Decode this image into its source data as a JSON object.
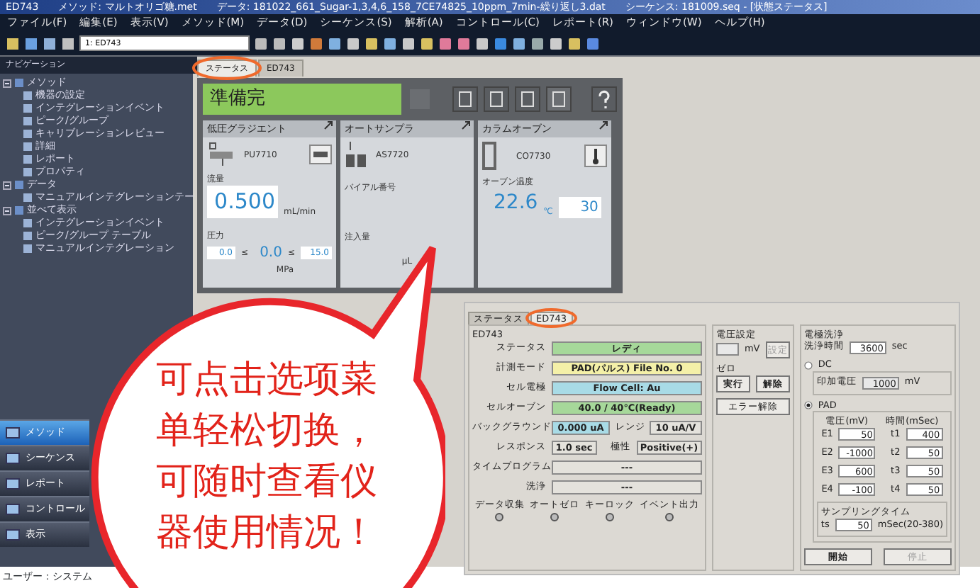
{
  "window": {
    "title": "ED743　　メソッド: マルトオリゴ糖.met　　データ: 181022_661_Sugar-1,3,4,6_158_7CE74825_10ppm_7min-繰り返し3.dat　　シーケンス: 181009.seq - [状態ステータス]"
  },
  "menu": [
    "ファイル(F)",
    "編集(E)",
    "表示(V)",
    "メソッド(M)",
    "データ(D)",
    "シーケンス(S)",
    "解析(A)",
    "コントロール(C)",
    "レポート(R)",
    "ウィンドウ(W)",
    "ヘルプ(H)"
  ],
  "toolbar": {
    "combo": "1: ED743"
  },
  "navigation": {
    "title": "ナビゲーション",
    "tree": [
      {
        "label": "メソッド",
        "expanded": true,
        "children": [
          {
            "label": "機器の設定"
          },
          {
            "label": "インテグレーションイベント"
          },
          {
            "label": "ピーク/グループ"
          },
          {
            "label": "キャリブレーションレビュー"
          },
          {
            "label": "詳細"
          },
          {
            "label": "レポート"
          },
          {
            "label": "プロパティ"
          }
        ]
      },
      {
        "label": "データ",
        "expanded": true,
        "children": [
          {
            "label": "マニュアルインテグレーションテー"
          }
        ]
      },
      {
        "label": "並べて表示",
        "expanded": true,
        "children": [
          {
            "label": "インテグレーションイベント"
          },
          {
            "label": "ピーク/グループ テーブル"
          },
          {
            "label": "マニュアルインテグレーション"
          }
        ]
      }
    ],
    "buttons": [
      {
        "label": "メソッド",
        "selected": true
      },
      {
        "label": "シーケンス",
        "selected": false
      },
      {
        "label": "レポート",
        "selected": false
      },
      {
        "label": "コントロール",
        "selected": false
      },
      {
        "label": "表示",
        "selected": false
      }
    ]
  },
  "tabs": [
    {
      "label": "ステータス",
      "selected": true
    },
    {
      "label": "ED743",
      "selected": false
    }
  ],
  "status": {
    "text": "準備完"
  },
  "modules": [
    {
      "kind": "pump",
      "title": "低圧グラジエント",
      "device": "PU7710",
      "flow_label": "流量",
      "flow": "0.500",
      "flow_unit": "mL/min",
      "pressure_label": "圧力",
      "pressure_min": "0.0",
      "pressure": "0.0",
      "pressure_max": "15.0",
      "le": "≤",
      "pressure_unit": "MPa"
    },
    {
      "kind": "sampler",
      "title": "オートサンプラ",
      "device": "AS7720",
      "vial_label": "バイアル番号",
      "volume_label": "注入量",
      "volume_unit": "μL"
    },
    {
      "kind": "oven",
      "title": "カラムオーブン",
      "device": "CO7730",
      "temp_label": "オーブン温度",
      "temp": "22.6",
      "temp_unit": "℃",
      "setpoint": "30"
    }
  ],
  "inset": {
    "tabs": [
      {
        "label": "ステータス",
        "selected": false
      },
      {
        "label": "ED743",
        "selected": true
      }
    ],
    "group": "ED743",
    "rows": [
      [
        {
          "label": "ステータス",
          "value": "レディ",
          "color": "#a6d89a"
        }
      ],
      [
        {
          "label": "計測モード",
          "value": "PAD(パルス) File No. 0",
          "color": "#f4f0a8"
        }
      ],
      [
        {
          "label": "セル電極",
          "value": "Flow Cell: Au",
          "color": "#a8dbe6"
        }
      ],
      [
        {
          "label": "セルオーブン",
          "value": "40.0 / 40℃(Ready)",
          "color": "#a6d89a"
        }
      ],
      [
        {
          "label": "バックグラウンド",
          "value": "0.000 uA",
          "color": "#a8dbe6"
        },
        {
          "label": "レンジ",
          "value": "10 uA/V",
          "color": "#e4e2dc"
        }
      ],
      [
        {
          "label": "レスポンス",
          "value": "1.0 sec",
          "color": "#e4e2dc"
        },
        {
          "label": "極性",
          "value": "Positive(+)",
          "color": "#e4e2dc"
        }
      ],
      [
        {
          "label": "タイムプログラム",
          "value": "---",
          "color": "#e4e2dc"
        }
      ],
      [
        {
          "label": "洗浄",
          "value": "---",
          "color": "#e4e2dc"
        }
      ]
    ],
    "indicators": [
      "データ収集",
      "オートゼロ",
      "キーロック",
      "イベント出力"
    ],
    "voltage": {
      "title": "電圧設定",
      "unit": "mV",
      "button": "設定"
    },
    "zero": {
      "title": "ゼロ",
      "buttons": [
        "実行",
        "解除"
      ]
    },
    "error_button": "エラー解除",
    "wash": {
      "title": "電極洗浄",
      "time_label": "洗浄時間",
      "time": "3600",
      "time_unit": "sec",
      "modes": [
        {
          "label": "DC",
          "selected": false
        },
        {
          "label": "PAD",
          "selected": true
        }
      ],
      "dc_label": "印加電圧",
      "dc_value": "1000",
      "dc_unit": "mV",
      "e_head": "電圧(mV)",
      "t_head": "時間(mSec)",
      "steps": [
        {
          "e_label": "E1",
          "e": "50",
          "t_label": "t1",
          "t": "400"
        },
        {
          "e_label": "E2",
          "e": "-1000",
          "t_label": "t2",
          "t": "50"
        },
        {
          "e_label": "E3",
          "e": "600",
          "t_label": "t3",
          "t": "50"
        },
        {
          "e_label": "E4",
          "e": "-100",
          "t_label": "t4",
          "t": "50"
        }
      ],
      "sampling_title": "サンプリングタイム",
      "ts_label": "ts",
      "ts": "50",
      "ts_unit": "mSec(20-380)",
      "buttons": [
        {
          "label": "開始",
          "disabled": false
        },
        {
          "label": "停止",
          "disabled": true
        }
      ]
    }
  },
  "callout": {
    "lines": [
      "可点击选项菜",
      "单轻松切换，",
      "可随时查看仪",
      "器使用情况！"
    ]
  },
  "status_bar": "ユーザー：システム"
}
